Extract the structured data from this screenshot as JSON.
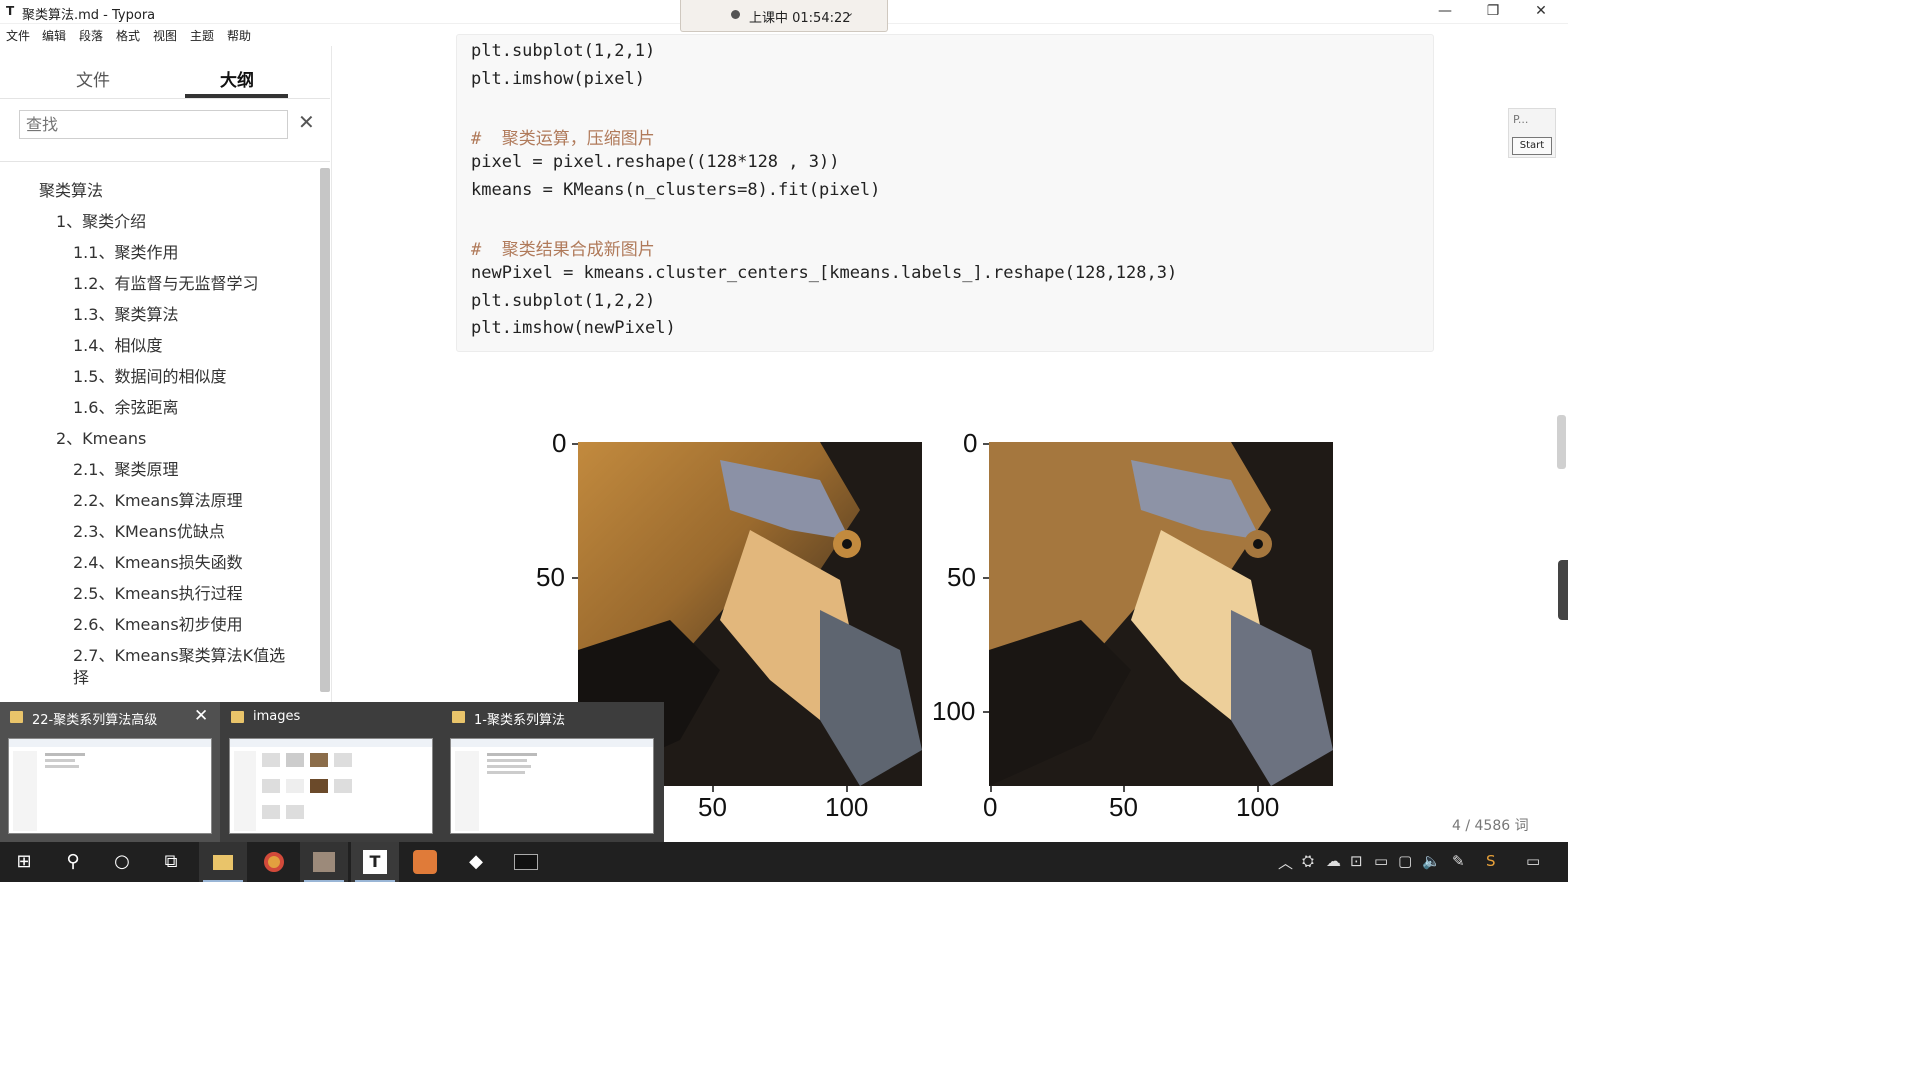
{
  "window": {
    "title": "聚类算法.md - Typora"
  },
  "timer": {
    "text": "上课中 01:54:22"
  },
  "menu": [
    "文件",
    "编辑",
    "段落",
    "格式",
    "视图",
    "主题",
    "帮助"
  ],
  "sidebar": {
    "tabs": [
      {
        "label": "文件"
      },
      {
        "label": "大纲"
      }
    ],
    "search_placeholder": "查找",
    "outline": [
      "聚类算法",
      "1、聚类介绍",
      "1.1、聚类作用",
      "1.2、有监督与无监督学习",
      "1.3、聚类算法",
      "1.4、相似度",
      "1.5、数据间的相似度",
      "1.6、余弦距离",
      "2、Kmeans",
      "2.1、聚类原理",
      "2.2、Kmeans算法原理",
      "2.3、KMeans优缺点",
      "2.4、Kmeans损失函数",
      "2.5、Kmeans执行过程",
      "2.6、Kmeans初步使用",
      "2.7、Kmeans聚类算法K值选",
      "择"
    ]
  },
  "code": {
    "lines": [
      "plt.subplot(1,2,1)",
      "plt.imshow(pixel)",
      "",
      "#  聚类运算，压缩图片",
      "pixel = pixel.reshape((128*128 , 3))",
      "kmeans = KMeans(n_clusters=8).fit(pixel)",
      "",
      "#  聚类结果合成新图片",
      "newPixel = kmeans.cluster_centers_[kmeans.labels_].reshape(128,128,3)",
      "plt.subplot(1,2,2)",
      "plt.imshow(newPixel)"
    ]
  },
  "figure": {
    "left_yticks": [
      "0",
      "50"
    ],
    "left_xticks": [
      "50",
      "100"
    ],
    "right_yticks": [
      "0",
      "50",
      "100"
    ],
    "right_xticks": [
      "0",
      "50",
      "100"
    ]
  },
  "status": {
    "word_count": "4 / 4586 词"
  },
  "float_widget": {
    "p_label": "P...",
    "start_label": "Start"
  },
  "taskbar_popup": [
    {
      "title": "22-聚类系列算法高级",
      "close": "✕"
    },
    {
      "title": "images"
    },
    {
      "title": "1-聚类系列算法"
    }
  ],
  "taskbar": {
    "apps": [
      "start-icon",
      "search-icon",
      "cortana-icon",
      "task-view-icon",
      "file-explorer-icon",
      "chrome-icon",
      "photos-icon",
      "typora-icon",
      "ppt-icon",
      "app-icon",
      "terminal-icon"
    ],
    "tray": [
      "chevron-up-icon",
      "tray-icon",
      "cloud-icon",
      "network-icon",
      "battery-icon",
      "display-icon",
      "volume-icon",
      "pen-icon",
      "app-tray-icon",
      "notification-icon"
    ]
  },
  "colors": {
    "accent": "#333333",
    "taskbar": "#202020",
    "code_comment": "#b07a5a"
  }
}
